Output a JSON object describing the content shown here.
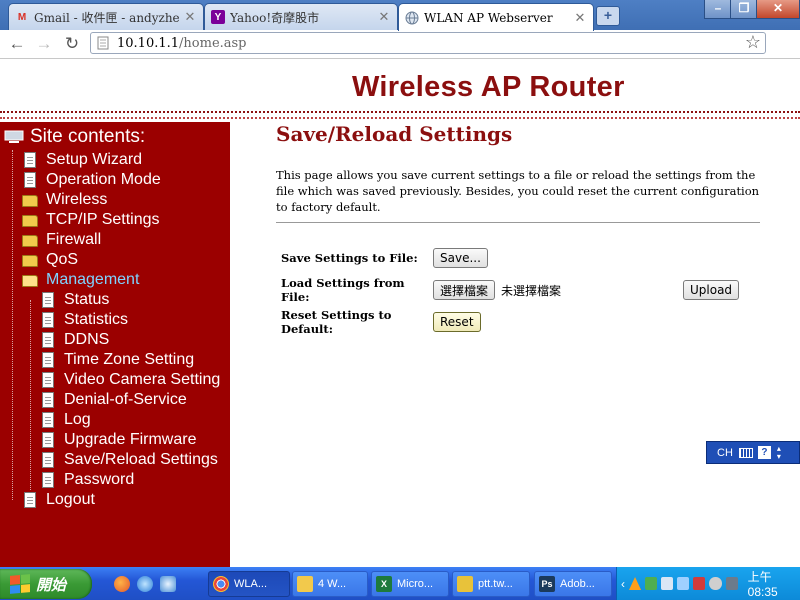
{
  "browser": {
    "tabs": [
      {
        "title": "Gmail - 收件匣 - andyzhengsh",
        "favicon": "gmail-icon",
        "active": false
      },
      {
        "title": "Yahoo!奇摩股市",
        "favicon": "yahoo-icon",
        "active": false
      },
      {
        "title": "WLAN AP Webserver",
        "favicon": "globe-icon",
        "active": true
      }
    ],
    "new_tab_label": "+",
    "window_buttons": {
      "minimize": "–",
      "restore": "❐",
      "close": "✕"
    },
    "address": {
      "host": "10.10.1.1",
      "path": "/home.asp"
    }
  },
  "page": {
    "banner_title": "Wireless AP Router",
    "sidebar": {
      "header": "Site contents:",
      "items": [
        {
          "label": "Setup Wizard",
          "icon": "document-icon",
          "level": 1
        },
        {
          "label": "Operation Mode",
          "icon": "document-icon",
          "level": 1
        },
        {
          "label": "Wireless",
          "icon": "folder-icon",
          "level": 1
        },
        {
          "label": "TCP/IP Settings",
          "icon": "folder-icon",
          "level": 1
        },
        {
          "label": "Firewall",
          "icon": "folder-icon",
          "level": 1
        },
        {
          "label": "QoS",
          "icon": "folder-icon",
          "level": 1
        },
        {
          "label": "Management",
          "icon": "folder-open-icon",
          "level": 1
        },
        {
          "label": "Status",
          "icon": "document-icon",
          "level": 2
        },
        {
          "label": "Statistics",
          "icon": "document-icon",
          "level": 2
        },
        {
          "label": "DDNS",
          "icon": "document-icon",
          "level": 2
        },
        {
          "label": "Time Zone Setting",
          "icon": "document-icon",
          "level": 2
        },
        {
          "label": "Video Camera Setting",
          "icon": "document-icon",
          "level": 2
        },
        {
          "label": "Denial-of-Service",
          "icon": "document-icon",
          "level": 2
        },
        {
          "label": "Log",
          "icon": "document-icon",
          "level": 2
        },
        {
          "label": "Upgrade Firmware",
          "icon": "document-icon",
          "level": 2
        },
        {
          "label": "Save/Reload Settings",
          "icon": "document-icon",
          "level": 2
        },
        {
          "label": "Password",
          "icon": "document-icon",
          "level": 2
        },
        {
          "label": "Logout",
          "icon": "document-icon",
          "level": 1
        }
      ]
    },
    "content": {
      "heading": "Save/Reload Settings",
      "description": "This page allows you save current settings to a file or reload the settings from the file which was saved previously. Besides, you could reset the current configuration to factory default.",
      "rows": {
        "save": {
          "label": "Save Settings to File:",
          "button": "Save..."
        },
        "load": {
          "label": "Load Settings from File:",
          "choose_button": "選擇檔案",
          "no_file": "未選擇檔案",
          "upload_button": "Upload"
        },
        "reset": {
          "label": "Reset Settings to Default:",
          "button": "Reset"
        }
      }
    },
    "ime": {
      "label": "CH"
    }
  },
  "taskbar": {
    "start_label": "開始",
    "tasks": [
      {
        "label": "WLA...",
        "icon": "chrome-icon",
        "active": true
      },
      {
        "label": "4 W...",
        "icon": "folder-icon",
        "active": false
      },
      {
        "label": "Micro...",
        "icon": "excel-icon",
        "active": false
      },
      {
        "label": "ptt.tw...",
        "icon": "putty-icon",
        "active": false
      },
      {
        "label": "Adob...",
        "icon": "photoshop-icon",
        "active": false
      }
    ],
    "clock": "上午 08:35"
  },
  "colors": {
    "accent": "#8b0f0f",
    "sidebar_bg": "#9b0000",
    "current_item": "#7fd3ff"
  }
}
